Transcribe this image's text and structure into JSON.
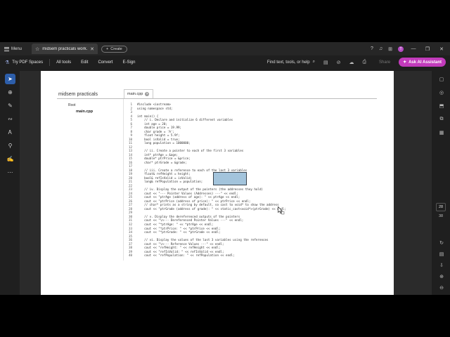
{
  "titlebar": {
    "menu_label": "Menu",
    "tab_title": "midsem practicals work...",
    "create_label": "Create",
    "avatar_initial": "T",
    "icons": [
      "help-icon",
      "bell-icon",
      "apps-grid-icon"
    ]
  },
  "toolbar": {
    "spaces_label": "Try PDF Spaces",
    "all_tools_label": "All tools",
    "edit_label": "Edit",
    "convert_label": "Convert",
    "esign_label": "E-Sign",
    "search_label": "Find text, tools, or help",
    "share_label": "Share",
    "ai_label": "Ask AI Assistant"
  },
  "sidebar": {
    "tools": [
      "select-cursor-icon",
      "zoom-comment-icon",
      "pen-draw-icon",
      "highlight-icon",
      "text-edit-icon",
      "stamp-icon",
      "signature-icon",
      "more-icon"
    ]
  },
  "rightpanel": {
    "current_page": "28",
    "total_pages": "38"
  },
  "document": {
    "folder_title": "midsem practicals",
    "tab_filename": "main.cpp",
    "tree_root": "Root",
    "tree_file": "main.cpp",
    "code_lines": [
      {
        "n": "1",
        "t": "#include <iostream>"
      },
      {
        "n": "2",
        "t": "using namespace std;"
      },
      {
        "n": "3",
        "t": ""
      },
      {
        "n": "4",
        "t": "int main() {"
      },
      {
        "n": "5",
        "t": "    // i. Declare and initialize 6 different variables"
      },
      {
        "n": "6",
        "t": "    int age = 20;"
      },
      {
        "n": "7",
        "t": "    double price = 19.99;"
      },
      {
        "n": "8",
        "t": "    char grade = 'A';"
      },
      {
        "n": "9",
        "t": "    float height = 5.9f;"
      },
      {
        "n": "10",
        "t": "    bool isValid = true;"
      },
      {
        "n": "11",
        "t": "    long population = 1000000;"
      },
      {
        "n": "12",
        "t": ""
      },
      {
        "n": "13",
        "t": "    // ii. Create a pointer to each of the first 3 variables"
      },
      {
        "n": "14",
        "t": "    int* ptrAge = &age;"
      },
      {
        "n": "15",
        "t": "    double* ptrPrice = &price;"
      },
      {
        "n": "16",
        "t": "    char* ptrGrade = &grade;"
      },
      {
        "n": "17",
        "t": ""
      },
      {
        "n": "18",
        "t": "    // iii. Create a reference to each of the last 3 variables"
      },
      {
        "n": "19",
        "t": "    float& refHeight = height;"
      },
      {
        "n": "20",
        "t": "    bool& refIsValid = isValid;"
      },
      {
        "n": "21",
        "t": "    long& refPopulation = population;"
      },
      {
        "n": "22",
        "t": ""
      },
      {
        "n": "23",
        "t": "    // iv. Display the output of the pointers (the addresses they hold)"
      },
      {
        "n": "24",
        "t": "    cout << \"--- Pointer Values (Addresses) ---\" << endl;"
      },
      {
        "n": "25",
        "t": "    cout << \"ptrAge (address of age): \" << ptrAge << endl;"
      },
      {
        "n": "26",
        "t": "    cout << \"ptrPrice (address of price): \" << ptrPrice << endl;"
      },
      {
        "n": "27",
        "t": "    // char* prints as a string by default, so cast to void* to show the address"
      },
      {
        "n": "28",
        "t": "    cout << \"ptrGrade (address of grade): \" << static_cast<void*>(ptrGrade) << endl;"
      },
      {
        "n": "29",
        "t": ""
      },
      {
        "n": "30",
        "t": "    // v. Display the dereferenced outputs of the pointers"
      },
      {
        "n": "31",
        "t": "    cout << \"\\n--- Dereferenced Pointer Values ---\" << endl;"
      },
      {
        "n": "32",
        "t": "    cout << \"*ptrAge: \" << *ptrAge << endl;"
      },
      {
        "n": "33",
        "t": "    cout << \"*ptrPrice: \" << *ptrPrice << endl;"
      },
      {
        "n": "34",
        "t": "    cout << \"*ptrGrade: \" << *ptrGrade << endl;"
      },
      {
        "n": "35",
        "t": ""
      },
      {
        "n": "36",
        "t": "    // vi. Display the values of the last 3 variables using the references"
      },
      {
        "n": "37",
        "t": "    cout << \"\\n--- Reference Values ---\" << endl;"
      },
      {
        "n": "38",
        "t": "    cout << \"refHeight: \" << refHeight << endl;"
      },
      {
        "n": "39",
        "t": "    cout << \"refIsValid: \" << refIsValid << endl;"
      },
      {
        "n": "40",
        "t": "    cout << \"refPopulation: \" << refPopulation << endl;"
      }
    ]
  },
  "colors": {
    "accent": "#2d5eaa",
    "ai_button": "#c23bbb",
    "shape_fill": "#a3c4dc"
  }
}
